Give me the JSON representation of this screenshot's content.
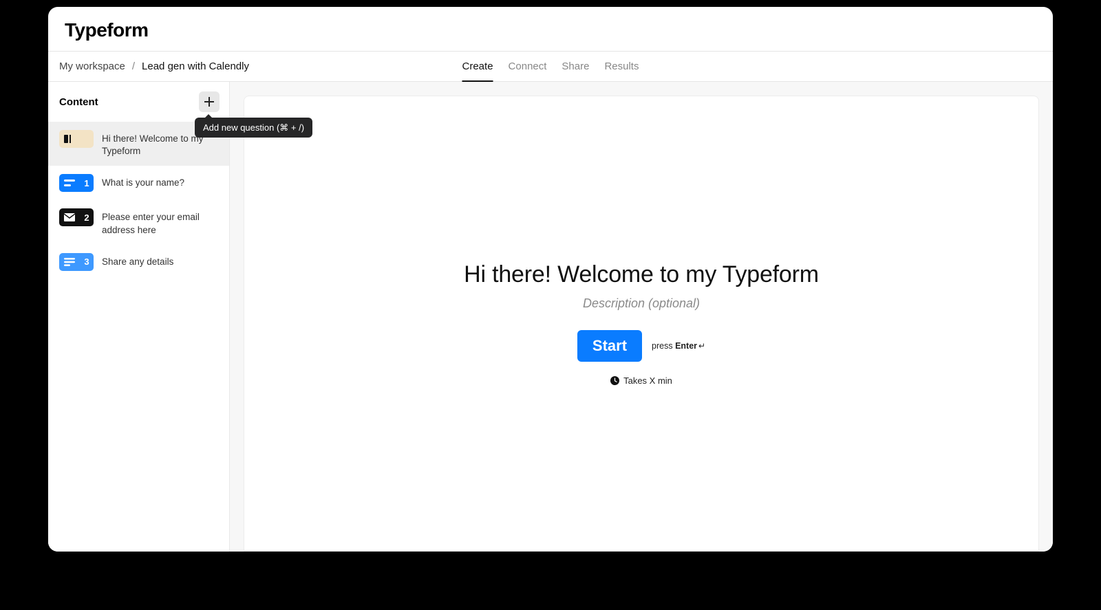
{
  "brand": "Typeform",
  "breadcrumbs": {
    "workspace": "My workspace",
    "separator": "/",
    "form": "Lead gen with Calendly"
  },
  "tabs": {
    "create": "Create",
    "connect": "Connect",
    "share": "Share",
    "results": "Results"
  },
  "sidebar": {
    "title": "Content",
    "add_tooltip": "Add new question (⌘ + /)",
    "items": [
      {
        "number": "",
        "label": "Hi there! Welcome to my Typeform"
      },
      {
        "number": "1",
        "label": "What is your name?"
      },
      {
        "number": "2",
        "label": "Please enter your email address here"
      },
      {
        "number": "3",
        "label": "Share any details"
      }
    ]
  },
  "canvas": {
    "title": "Hi there! Welcome to my Typeform",
    "description_placeholder": "Description (optional)",
    "start_label": "Start",
    "press_prefix": "press ",
    "press_key": "Enter",
    "enter_glyph": "↵",
    "takes_text": "Takes X min"
  }
}
